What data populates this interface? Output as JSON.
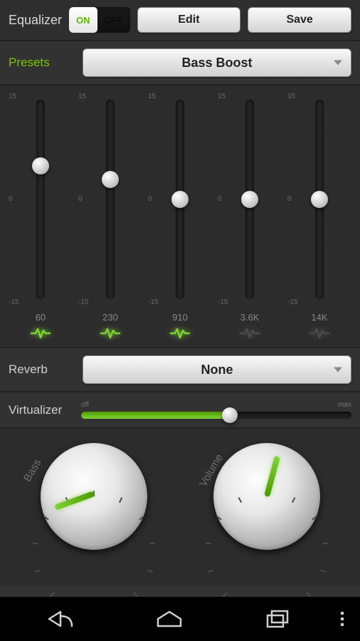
{
  "header": {
    "title": "Equalizer",
    "toggle_on": "ON",
    "toggle_off": "OFF",
    "edit_label": "Edit",
    "save_label": "Save"
  },
  "presets": {
    "label": "Presets",
    "selected": "Bass Boost"
  },
  "eq": {
    "scale_top": "15",
    "scale_mid": "0",
    "scale_bot": "-15",
    "bands": [
      {
        "freq": "60",
        "value": 5,
        "active": true
      },
      {
        "freq": "230",
        "value": 3,
        "active": true
      },
      {
        "freq": "910",
        "value": 0,
        "active": true
      },
      {
        "freq": "3.6K",
        "value": 0,
        "active": false
      },
      {
        "freq": "14K",
        "value": 0,
        "active": false
      }
    ]
  },
  "reverb": {
    "label": "Reverb",
    "selected": "None"
  },
  "virtualizer": {
    "label": "Virtualizer",
    "off_label": "off",
    "max_label": "max",
    "value_pct": 55
  },
  "knobs": {
    "bass": {
      "label": "Bass",
      "angle_deg": -110
    },
    "volume": {
      "label": "Volume",
      "angle_deg": 15
    }
  },
  "colors": {
    "accent": "#7fd335"
  }
}
